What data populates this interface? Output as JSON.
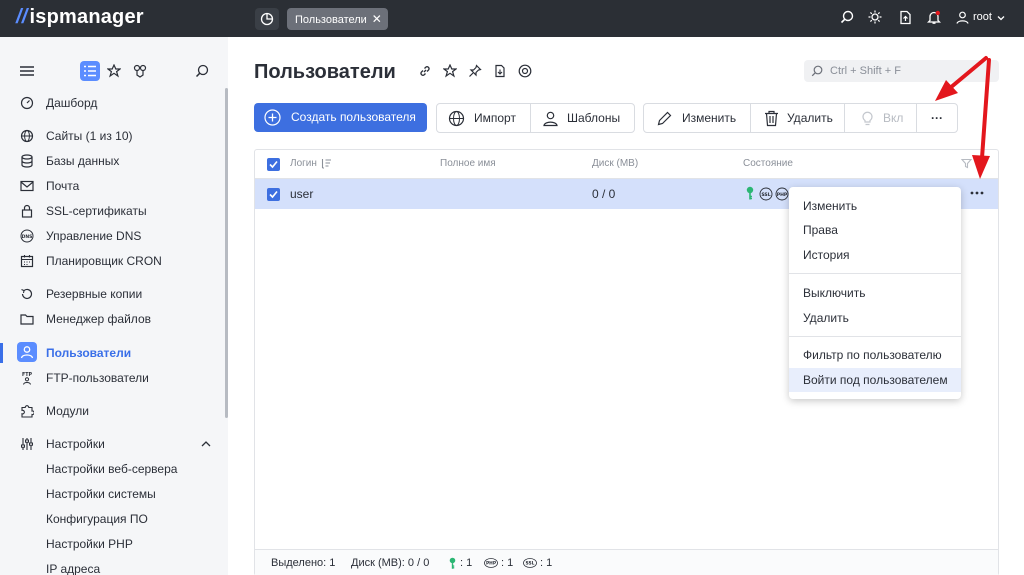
{
  "app": {
    "brand": "ispmanager",
    "tab_label": "Пользователи",
    "tab_close": "✕",
    "user": "root"
  },
  "sidebar": {
    "items": [
      {
        "label": "Дашборд",
        "icon": "speedometer-icon"
      },
      {
        "label": "Сайты (1 из 10)",
        "icon": "globe-icon"
      },
      {
        "label": "Базы данных",
        "icon": "database-icon"
      },
      {
        "label": "Почта",
        "icon": "mail-icon"
      },
      {
        "label": "SSL-сертификаты",
        "icon": "lock-icon"
      },
      {
        "label": "Управление DNS",
        "icon": "dns-icon"
      },
      {
        "label": "Планировщик CRON",
        "icon": "calendar-icon"
      },
      {
        "label": "Резервные копии",
        "icon": "backup-icon"
      },
      {
        "label": "Менеджер файлов",
        "icon": "folder-icon"
      },
      {
        "label": "Пользователи",
        "icon": "user-icon",
        "active": true
      },
      {
        "label": "FTP-пользователи",
        "icon": "ftp-icon"
      },
      {
        "label": "Модули",
        "icon": "puzzle-icon"
      },
      {
        "label": "Настройки",
        "icon": "sliders-icon"
      }
    ],
    "subitems": [
      "Настройки веб-сервера",
      "Настройки системы",
      "Конфигурация ПО",
      "Настройки PHP",
      "IP адреса"
    ]
  },
  "main": {
    "title": "Пользователи",
    "search_placeholder": "Ctrl + Shift + F",
    "create_button": "Создать пользователя",
    "import_button": "Импорт",
    "templates_button": "Шаблоны",
    "edit_button": "Изменить",
    "delete_button": "Удалить",
    "enable_button": "Вкл",
    "more_button": "···"
  },
  "table": {
    "columns": [
      "Логин",
      "Полное имя",
      "Диск (MB)",
      "Состояние"
    ],
    "rows": [
      {
        "login": "user",
        "full_name": "",
        "disk": "0 / 0",
        "status_icons": [
          "key-icon",
          "ssl-icon",
          "php-icon"
        ]
      }
    ],
    "footer": {
      "selected": "Выделено: 1",
      "disk": "Диск (MB): 0 / 0",
      "key_count": ": 1",
      "php_count": ": 1",
      "ssl_count": ": 1"
    }
  },
  "row_menu": {
    "groups": [
      [
        "Изменить",
        "Права",
        "История"
      ],
      [
        "Выключить",
        "Удалить"
      ],
      [
        "Фильтр по пользователю",
        "Войти под пользователем"
      ]
    ],
    "highlighted": "Войти под пользователем"
  },
  "colors": {
    "accent": "#3d6fe0",
    "topbar": "#2b2f35",
    "row_selected": "#d4e0fb",
    "arrow": "#e3171d"
  }
}
